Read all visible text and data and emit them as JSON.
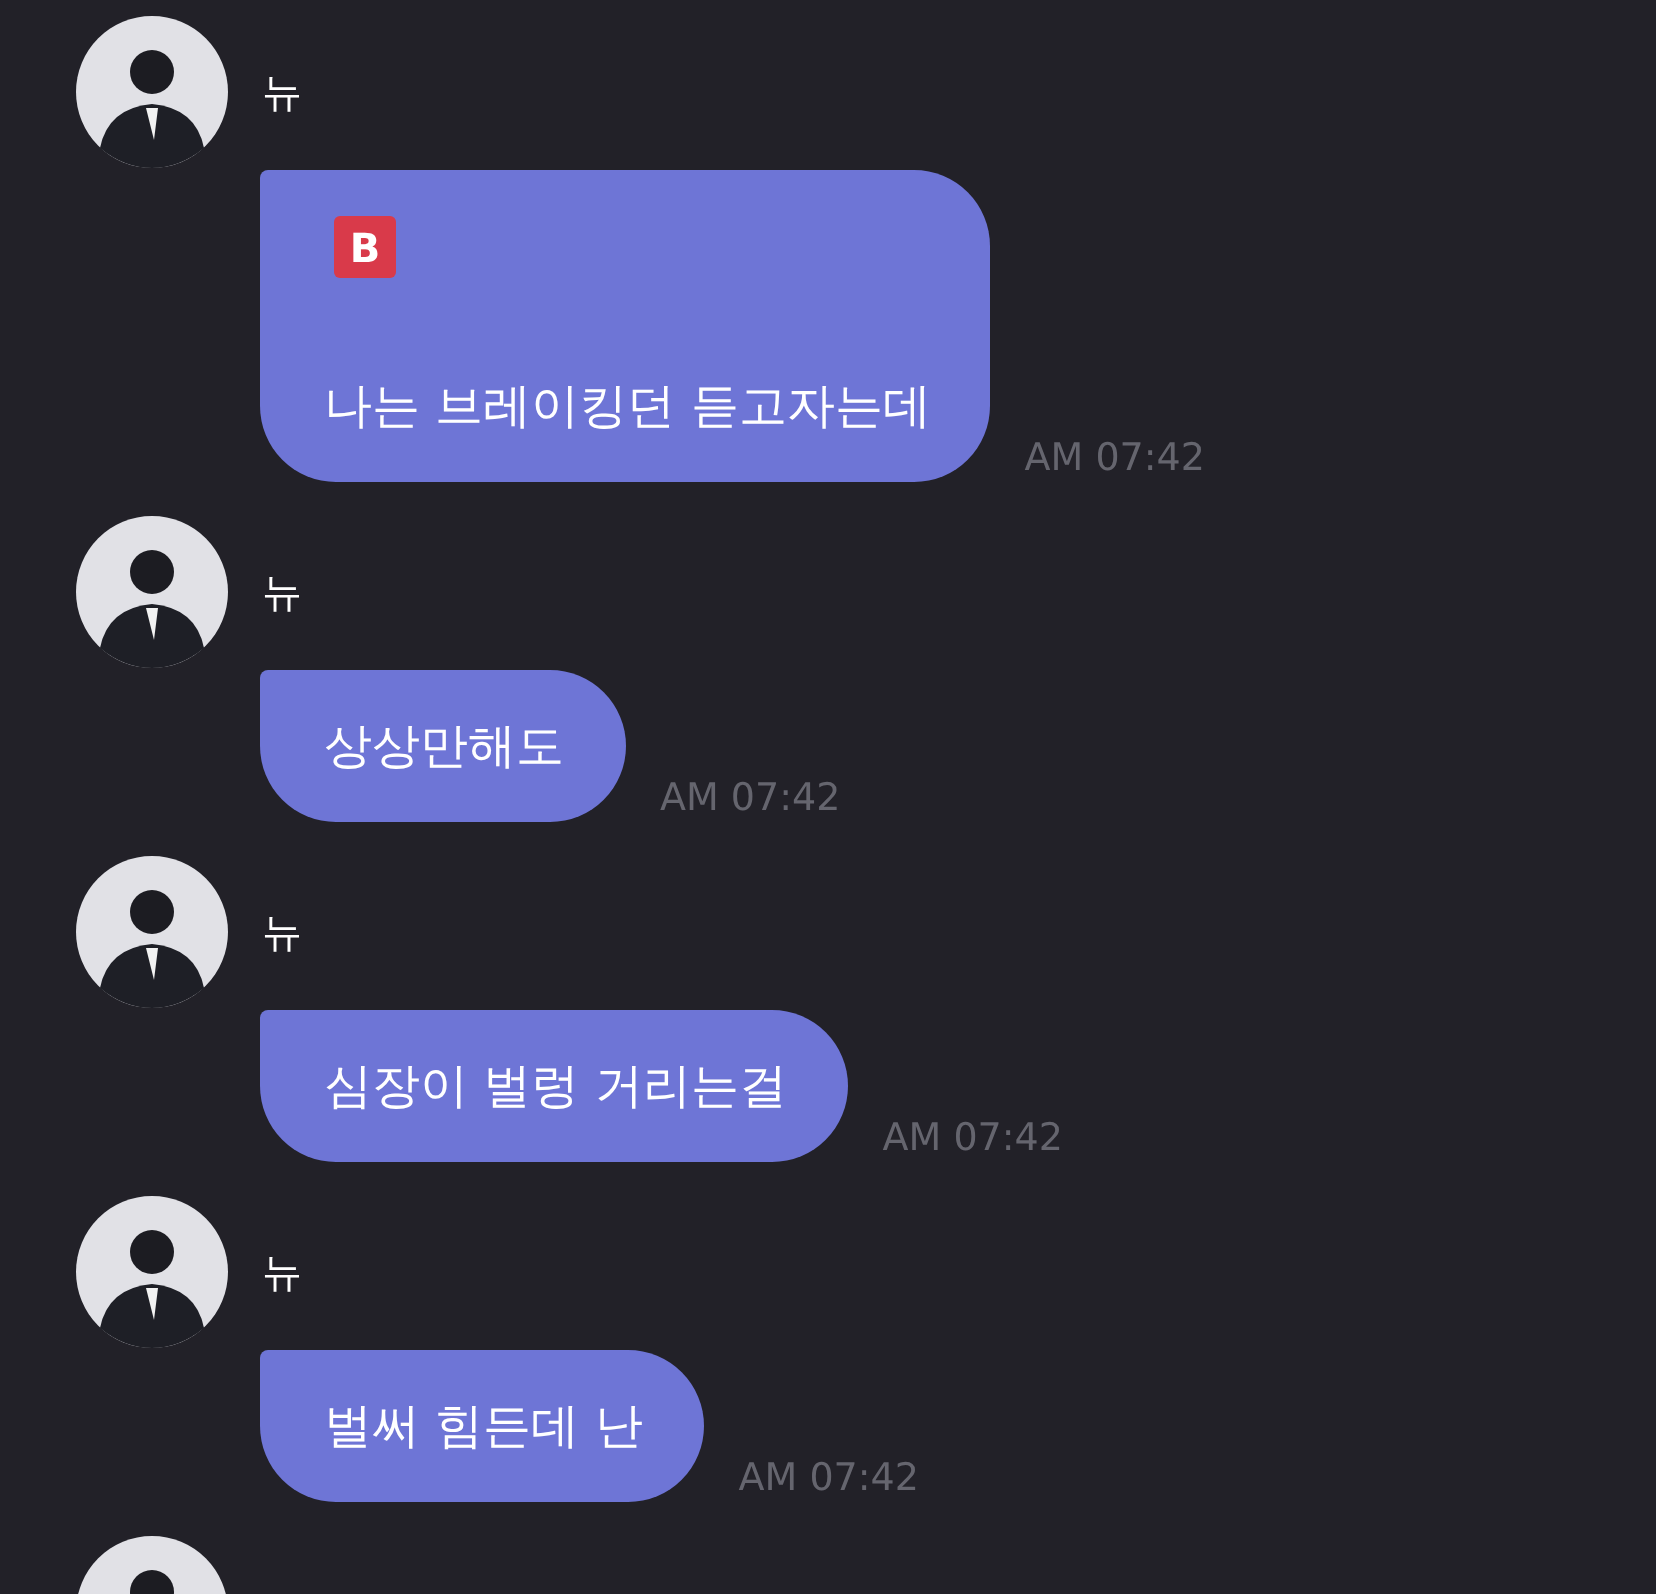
{
  "messages": [
    {
      "kind": "message",
      "sender": "뉴",
      "emoji": "B",
      "text": "나는 브레이킹던 듣고자는데",
      "time": "AM 07:42"
    },
    {
      "kind": "message",
      "sender": "뉴",
      "text": "상상만해도",
      "time": "AM 07:42"
    },
    {
      "kind": "message",
      "sender": "뉴",
      "text": "심장이 벌렁 거리는걸",
      "time": "AM 07:42"
    },
    {
      "kind": "message",
      "sender": "뉴",
      "text": "벌써 힘든데 난",
      "time": "AM 07:42"
    },
    {
      "kind": "cut"
    }
  ]
}
